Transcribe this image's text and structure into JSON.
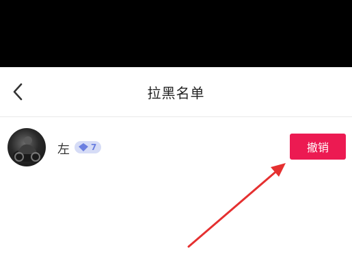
{
  "nav": {
    "title": "拉黑名单",
    "back_icon": "chevron-left-icon"
  },
  "blocked_list": [
    {
      "name": "左",
      "level": "7",
      "badge_icon": "diamond-icon",
      "action_label": "撤销"
    }
  ],
  "colors": {
    "status_bar": "#000000",
    "accent": "#ec1a52",
    "badge_bg": "#d6dcf6",
    "badge_fg": "#6b7fe0",
    "annotation_arrow": "#e53030"
  }
}
